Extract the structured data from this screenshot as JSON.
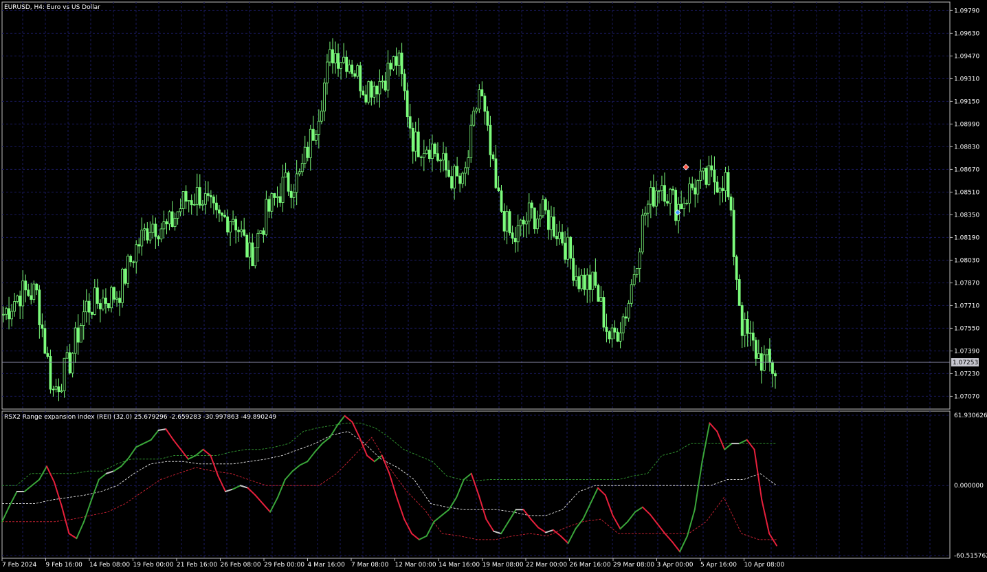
{
  "main_header": "EURUSD, H4:  Euro vs US Dollar",
  "indicator_header": "RSX2 Range expansion index (REI) (32.0) 25.679296 -2.659283 -30.997863 -49.890249",
  "current_price": "1.07253",
  "price_axis": [
    "1.09790",
    "1.09630",
    "1.09470",
    "1.09310",
    "1.09150",
    "1.08990",
    "1.08830",
    "1.08670",
    "1.08510",
    "1.08350",
    "1.08190",
    "1.08030",
    "1.07870",
    "1.07710",
    "1.07550",
    "1.07390",
    "1.07230",
    "1.07070"
  ],
  "indicator_axis": [
    "61.930626",
    "0.000000",
    "-60.515762"
  ],
  "time_axis": [
    "7 Feb 2024",
    "9 Feb 16:00",
    "14 Feb 08:00",
    "19 Feb 00:00",
    "21 Feb 16:00",
    "26 Feb 08:00",
    "29 Feb 00:00",
    "4 Mar 16:00",
    "7 Mar 08:00",
    "12 Mar 00:00",
    "14 Mar 16:00",
    "19 Mar 08:00",
    "22 Mar 00:00",
    "26 Mar 16:00",
    "29 Mar 08:00",
    "3 Apr 00:00",
    "5 Apr 16:00",
    "10 Apr 08:00"
  ],
  "colors": {
    "background": "#000000",
    "grid": "#1a1a5e",
    "candle": "#7cfc7c",
    "rei_up": "#3aa63a",
    "rei_down": "#e8203c",
    "rei_neutral": "#c8c8c8",
    "level_upper": "#2f8f2f",
    "level_mid": "#d0d0d0",
    "level_lower": "#c02030",
    "price_line": "#8a8aa8"
  },
  "chart_data": [
    {
      "type": "candlestick",
      "symbol": "EURUSD",
      "timeframe": "H4",
      "ylim": [
        1.0698,
        1.0985
      ],
      "anchors": [
        [
          "7 Feb 2024",
          1.0765
        ],
        [
          "8 Feb",
          1.078
        ],
        [
          "9 Feb 16:00",
          1.078
        ],
        [
          "13 Feb",
          1.071
        ],
        [
          "14 Feb 08:00",
          1.073
        ],
        [
          "15 Feb",
          1.077
        ],
        [
          "16 Feb",
          1.0775
        ],
        [
          "19 Feb 00:00",
          1.078
        ],
        [
          "20 Feb",
          1.081
        ],
        [
          "21 Feb 16:00",
          1.083
        ],
        [
          "22 Feb",
          1.0825
        ],
        [
          "23 Feb",
          1.0845
        ],
        [
          "26 Feb 08:00",
          1.085
        ],
        [
          "27 Feb",
          1.083
        ],
        [
          "28 Feb",
          1.0835
        ],
        [
          "29 Feb 00:00",
          1.0805
        ],
        [
          "1 Mar",
          1.0835
        ],
        [
          "4 Mar 16:00",
          1.0855
        ],
        [
          "5 Mar",
          1.086
        ],
        [
          "6 Mar",
          1.09
        ],
        [
          "7 Mar 08:00",
          1.095
        ],
        [
          "8 Mar",
          1.0945
        ],
        [
          "11 Mar",
          1.0925
        ],
        [
          "12 Mar 00:00",
          1.093
        ],
        [
          "13 Mar",
          1.0945
        ],
        [
          "14 Mar 16:00",
          1.0885
        ],
        [
          "15 Mar",
          1.0885
        ],
        [
          "18 Mar",
          1.0865
        ],
        [
          "19 Mar 08:00",
          1.0855
        ],
        [
          "20 Mar",
          1.0925
        ],
        [
          "21 Mar",
          1.085
        ],
        [
          "22 Mar 00:00",
          1.0815
        ],
        [
          "25 Mar",
          1.0835
        ],
        [
          "26 Mar 16:00",
          1.0835
        ],
        [
          "27 Mar",
          1.082
        ],
        [
          "28 Mar",
          1.079
        ],
        [
          "29 Mar 08:00",
          1.0785
        ],
        [
          "1 Apr",
          1.0745
        ],
        [
          "2 Apr",
          1.077
        ],
        [
          "3 Apr 00:00",
          1.0835
        ],
        [
          "4 Apr",
          1.086
        ],
        [
          "5 Apr 16:00",
          1.084
        ],
        [
          "8 Apr",
          1.0855
        ],
        [
          "9 Apr",
          1.086
        ],
        [
          "10 Apr 08:00",
          1.086
        ],
        [
          "10 Apr",
          1.0755
        ],
        [
          "11 Apr",
          1.0735
        ],
        [
          "11 Apr 12:00",
          1.0725
        ]
      ]
    },
    {
      "type": "line",
      "title": "RSX2 Range expansion index (REI) (32.0)",
      "ylim": [
        -60.515762,
        61.930626
      ],
      "series": [
        {
          "name": "REI",
          "values": [
            -30,
            -17,
            -5,
            -5,
            0,
            5,
            16,
            3,
            -17,
            -40,
            -44,
            -30,
            -12,
            5,
            10,
            12,
            16,
            23,
            32,
            35,
            38,
            46,
            47,
            38,
            30,
            22,
            25,
            30,
            25,
            8,
            -5,
            -3,
            0,
            -2,
            -8,
            -15,
            -22,
            -10,
            5,
            12,
            17,
            20,
            28,
            35,
            40,
            50,
            58,
            53,
            40,
            25,
            20,
            25,
            10,
            -10,
            -28,
            -40,
            -45,
            -42,
            -30,
            -25,
            -20,
            -10,
            5,
            10,
            -8,
            -28,
            -38,
            -40,
            -30,
            -20,
            -20,
            -28,
            -35,
            -39,
            -37,
            -42,
            -48,
            -36,
            -28,
            -15,
            -2,
            -8,
            -25,
            -36,
            -30,
            -22,
            -18,
            -24,
            -32,
            -40,
            -47,
            -55,
            -42,
            -20,
            20,
            52,
            45,
            30,
            35,
            35,
            38,
            30,
            -12,
            -40,
            -50
          ]
        },
        {
          "name": "upper level",
          "values": [
            0,
            0,
            10,
            10,
            10,
            10,
            12,
            12,
            18,
            22,
            22,
            22,
            25,
            25,
            25,
            25,
            28,
            30,
            30,
            32,
            35,
            45,
            48,
            50,
            52,
            52,
            48,
            40,
            30,
            25,
            20,
            8,
            5,
            4,
            5,
            5,
            5,
            5,
            5,
            5,
            5,
            5,
            5,
            5,
            8,
            10,
            25,
            28,
            35,
            35,
            35,
            35,
            35,
            35,
            35
          ]
        },
        {
          "name": "mid level",
          "values": [
            -15,
            -15,
            -15,
            -12,
            -10,
            -8,
            -5,
            0,
            10,
            18,
            20,
            20,
            18,
            18,
            18,
            20,
            22,
            25,
            30,
            35,
            42,
            45,
            35,
            22,
            15,
            5,
            -15,
            -18,
            -20,
            -20,
            -20,
            -22,
            -25,
            -25,
            -20,
            -5,
            0,
            0,
            0,
            0,
            0,
            0,
            0,
            0,
            5,
            5,
            10,
            0
          ]
        },
        {
          "name": "lower level",
          "values": [
            -30,
            -30,
            -30,
            -30,
            -28,
            -25,
            -22,
            -15,
            -5,
            5,
            10,
            15,
            12,
            10,
            5,
            0,
            0,
            0,
            0,
            10,
            25,
            40,
            15,
            -5,
            -20,
            -40,
            -42,
            -45,
            -45,
            -42,
            -40,
            -42,
            -35,
            -30,
            -28,
            -40,
            -40,
            -40,
            -40,
            -40,
            -30,
            -10,
            -40,
            -45,
            -45
          ]
        }
      ]
    }
  ]
}
